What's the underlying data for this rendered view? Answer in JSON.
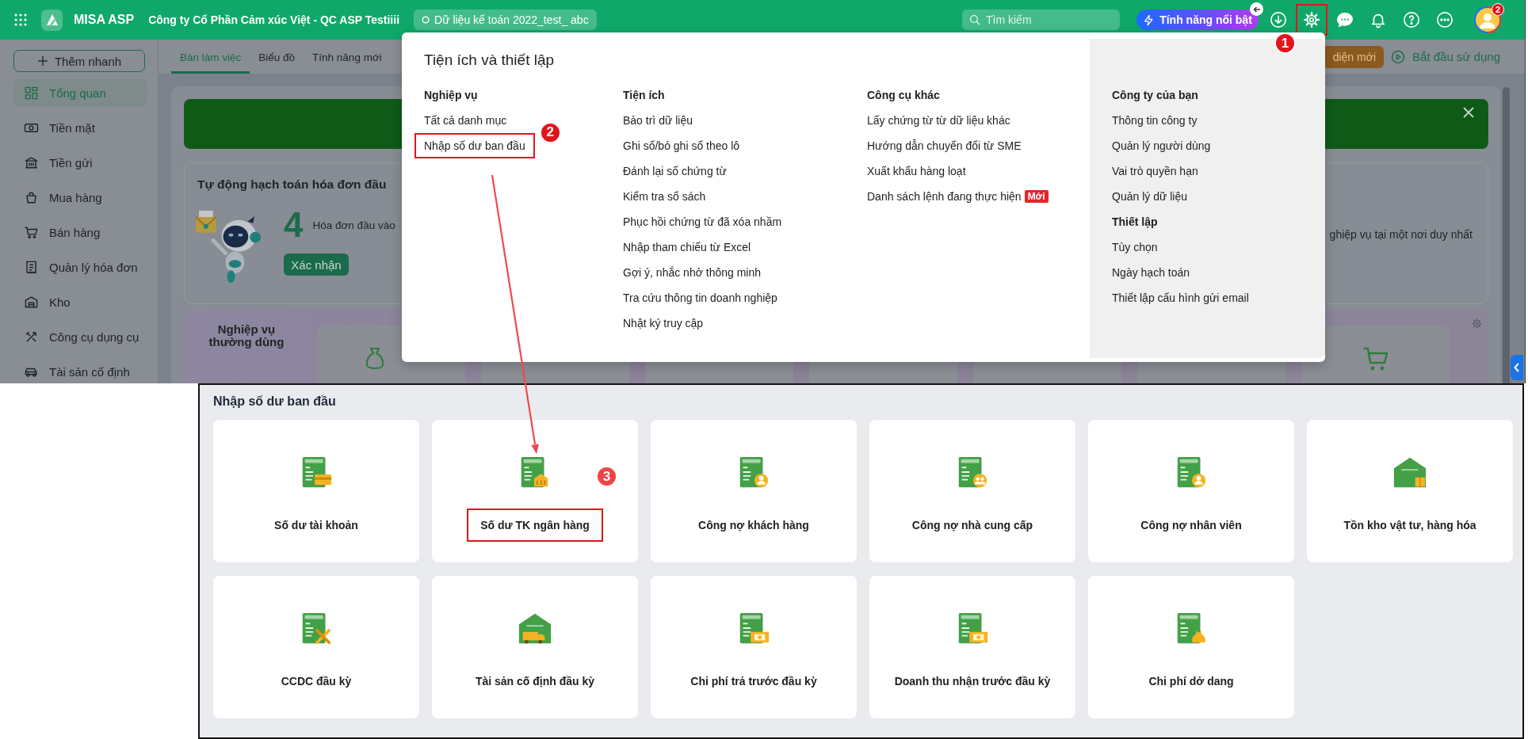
{
  "top_bar": {
    "app_name": "MISA ASP",
    "company": "Công ty Cổ Phần Cảm xúc Việt - QC ASP Testiiii",
    "dataset": "Dữ liệu kế toán 2022_test_ abc",
    "search": {
      "placeholder": "Tìm kiếm"
    },
    "feature_button": "Tính năng nổi bật",
    "icons": [
      {
        "kind": "download",
        "highlighted": false
      },
      {
        "kind": "settings",
        "highlighted": true,
        "step": "1"
      },
      {
        "kind": "chat",
        "highlighted": false
      },
      {
        "kind": "bell",
        "highlighted": false
      },
      {
        "kind": "help",
        "highlighted": false
      },
      {
        "kind": "more",
        "highlighted": false
      }
    ],
    "notification_count": "2"
  },
  "sidebar": {
    "quick_add": "Thêm nhanh",
    "items": [
      {
        "kind": "overview",
        "label": "Tổng quan",
        "selected": true
      },
      {
        "kind": "cash",
        "label": "Tiền mặt",
        "selected": false
      },
      {
        "kind": "bank",
        "label": "Tiền gửi",
        "selected": false
      },
      {
        "kind": "purchase",
        "label": "Mua hàng",
        "selected": false
      },
      {
        "kind": "sales",
        "label": "Bán hàng",
        "selected": false
      },
      {
        "kind": "invoice",
        "label": "Quản lý hóa đơn",
        "selected": false
      },
      {
        "kind": "warehouse",
        "label": "Kho",
        "selected": false
      },
      {
        "kind": "tools",
        "label": "Công cụ dụng cụ",
        "selected": false
      },
      {
        "kind": "asset",
        "label": "Tài sản cố định",
        "selected": false
      }
    ]
  },
  "tabs": [
    {
      "label": "Bàn làm việc",
      "selected": true
    },
    {
      "label": "Biểu đồ",
      "selected": false
    },
    {
      "label": "Tính năng mới",
      "selected": false
    }
  ],
  "header_actions": {
    "new_ui_button": "diện mới",
    "start_link": "Bắt đầu sử dụng"
  },
  "invoice_card": {
    "title": "Tự động hạch toán hóa đơn đầu",
    "count": "4",
    "count_label": "Hóa đơn đầu vào",
    "confirm_button": "Xác nhận",
    "note": "ghiệp vụ tại một nơi duy nhất"
  },
  "frequent_card": {
    "title": "Nghiệp vụ thường dùng"
  },
  "settings_menu": {
    "title": "Tiện ích và thiết lập",
    "columns": [
      {
        "shaded": false,
        "sections": [
          {
            "heading": "Nghiệp vụ",
            "items": [
              {
                "label": "Tất cả danh mục",
                "highlighted": false
              },
              {
                "label": "Nhập số dư ban đầu",
                "highlighted": true,
                "step": "2"
              }
            ]
          }
        ]
      },
      {
        "shaded": false,
        "sections": [
          {
            "heading": "Tiện ích",
            "items": [
              {
                "label": "Bảo trì dữ liệu",
                "highlighted": false
              },
              {
                "label": "Ghi sổ/bỏ ghi sổ theo lô",
                "highlighted": false
              },
              {
                "label": "Đánh lại số chứng từ",
                "highlighted": false
              },
              {
                "label": "Kiểm tra sổ sách",
                "highlighted": false
              },
              {
                "label": "Phục hồi chứng từ đã xóa nhầm",
                "highlighted": false
              },
              {
                "label": "Nhập tham chiếu từ Excel",
                "highlighted": false
              },
              {
                "label": "Gợi ý, nhắc nhở thông minh",
                "highlighted": false
              },
              {
                "label": "Tra cứu thông tin doanh nghiệp",
                "highlighted": false
              },
              {
                "label": "Nhật ký truy cập",
                "highlighted": false
              }
            ]
          }
        ]
      },
      {
        "shaded": false,
        "sections": [
          {
            "heading": "Công cụ khác",
            "items": [
              {
                "label": "Lấy chứng từ từ dữ liệu khác",
                "highlighted": false
              },
              {
                "label": "Hướng dẫn chuyển đổi từ SME",
                "highlighted": false
              },
              {
                "label": "Xuất khẩu hàng loạt",
                "highlighted": false
              },
              {
                "label": "Danh sách lệnh đang thực hiện",
                "badge": "Mới",
                "highlighted": false
              }
            ]
          }
        ]
      },
      {
        "shaded": true,
        "sections": [
          {
            "heading": "Công ty của bạn",
            "items": [
              {
                "label": "Thông tin công ty",
                "highlighted": false
              },
              {
                "label": "Quản lý người dùng",
                "highlighted": false
              },
              {
                "label": "Vai trò quyền hạn",
                "highlighted": false
              },
              {
                "label": "Quản lý dữ liệu",
                "highlighted": false
              }
            ]
          },
          {
            "heading": "Thiết lập",
            "items": [
              {
                "label": "Tùy chọn",
                "highlighted": false
              },
              {
                "label": "Ngày hạch toán",
                "highlighted": false
              },
              {
                "label": "Thiết lập cấu hình gửi email",
                "highlighted": false
              }
            ]
          }
        ]
      }
    ]
  },
  "balance_panel": {
    "title": "Nhập số dư ban đầu",
    "tiles": [
      {
        "kind": "card",
        "label": "Số dư tài khoản",
        "highlighted": false
      },
      {
        "kind": "bank",
        "label": "Số dư TK ngân hàng",
        "highlighted": true,
        "step": "3"
      },
      {
        "kind": "customer",
        "label": "Công nợ khách hàng",
        "highlighted": false
      },
      {
        "kind": "supplier",
        "label": "Công nợ nhà cung cấp",
        "highlighted": false
      },
      {
        "kind": "employee",
        "label": "Công nợ nhân viên",
        "highlighted": false
      },
      {
        "kind": "warehouse",
        "label": "Tồn kho vật tư, hàng hóa",
        "highlighted": false
      },
      {
        "kind": "tools",
        "label": "CCDC đầu kỳ",
        "highlighted": false
      },
      {
        "kind": "asset",
        "label": "Tài sản cố định đầu kỳ",
        "highlighted": false
      },
      {
        "kind": "prepaid",
        "label": "Chi phí trả trước đầu kỳ",
        "highlighted": false
      },
      {
        "kind": "revenue",
        "label": "Doanh thu nhận trước đầu kỳ",
        "highlighted": false
      },
      {
        "kind": "wip",
        "label": "Chi phí dở dang",
        "highlighted": false
      }
    ]
  }
}
